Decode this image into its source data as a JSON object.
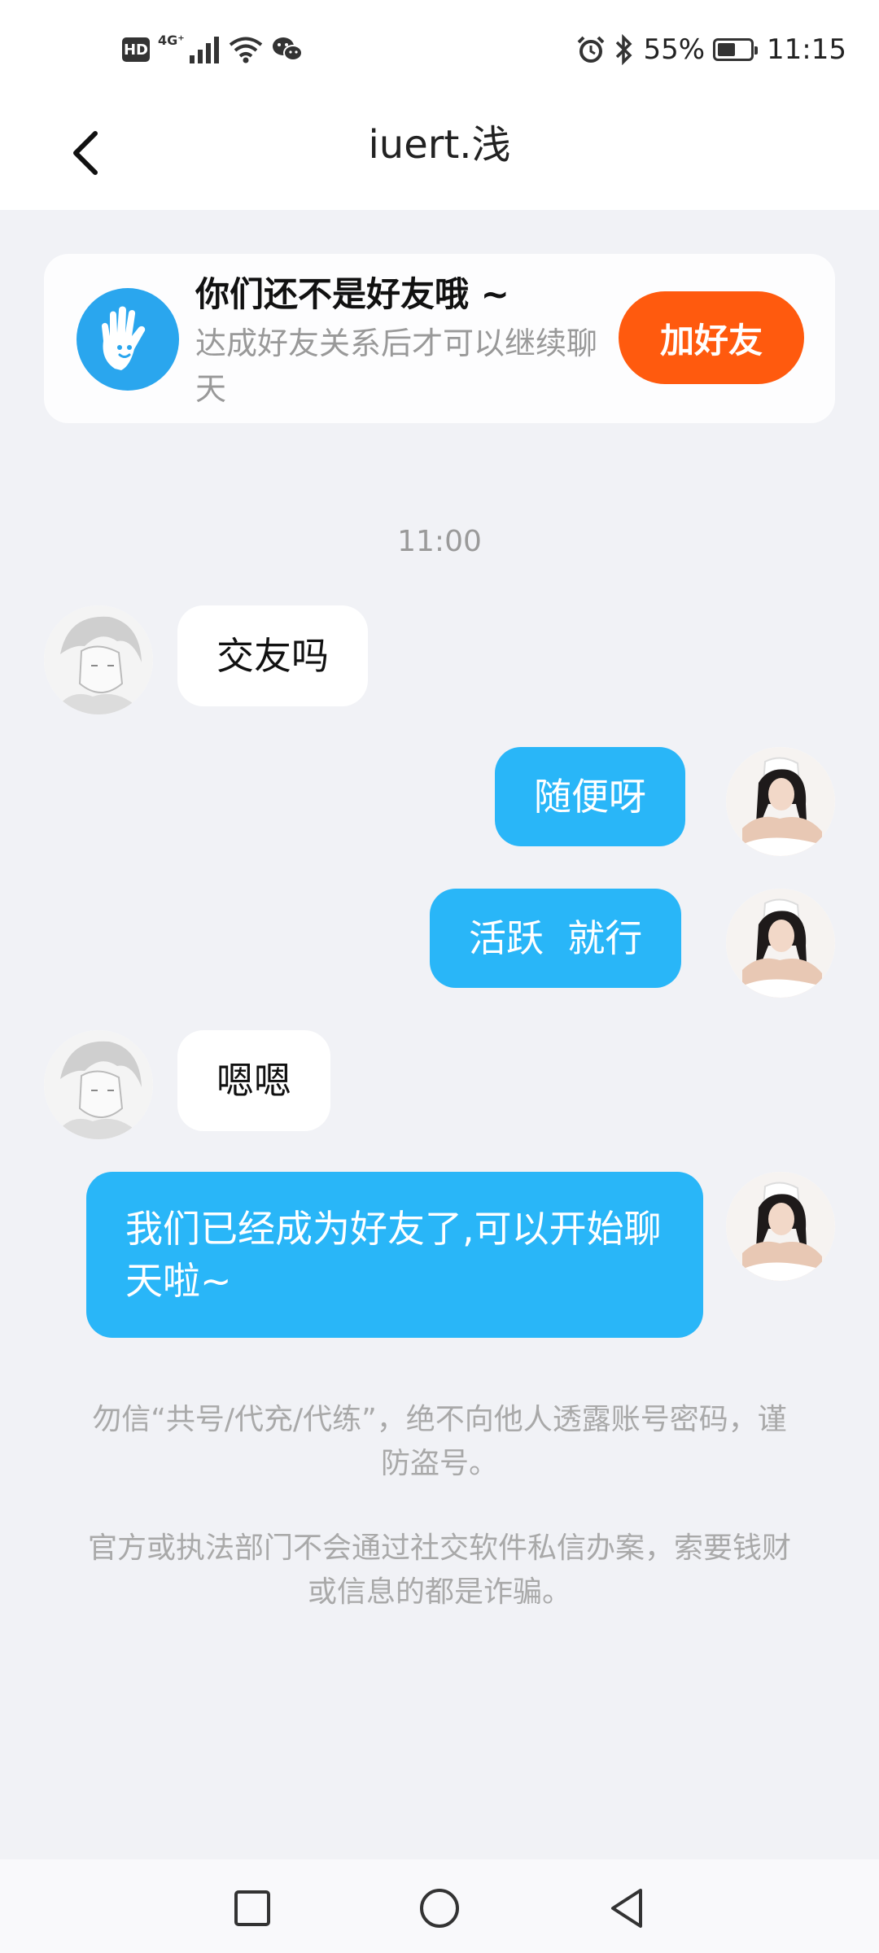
{
  "status_bar": {
    "hd": "HD",
    "network": "4G⁺",
    "battery_percent": "55%",
    "battery_level": 0.55,
    "time": "11:15"
  },
  "header": {
    "title": "iuert.浅"
  },
  "notice": {
    "title": "你们还不是好友哦 ~",
    "subtitle": "达成好友关系后才可以继续聊天",
    "add_button": "加好友"
  },
  "chat": {
    "timestamp": "11:00",
    "messages": [
      {
        "side": "in",
        "text": "交友吗"
      },
      {
        "side": "out",
        "text": "随便呀"
      },
      {
        "side": "out",
        "text": "活跃  就行"
      },
      {
        "side": "in",
        "text": "嗯嗯"
      },
      {
        "side": "out",
        "text": "我们已经成为好友了,可以开始聊天啦~"
      }
    ]
  },
  "warnings": [
    "勿信“共号/代充/代练”，绝不向他人透露账号密码，谨防盗号。",
    "官方或执法部门不会通过社交软件私信办案，索要钱财或信息的都是诈骗。"
  ],
  "colors": {
    "accent_blue": "#29b6f8",
    "add_button": "#ff5a0e",
    "background": "#f1f2f6"
  },
  "icons": {
    "back": "chevron-left-icon",
    "notice": "hand-wave-icon",
    "nav": [
      "square-icon",
      "circle-icon",
      "triangle-back-icon"
    ]
  }
}
